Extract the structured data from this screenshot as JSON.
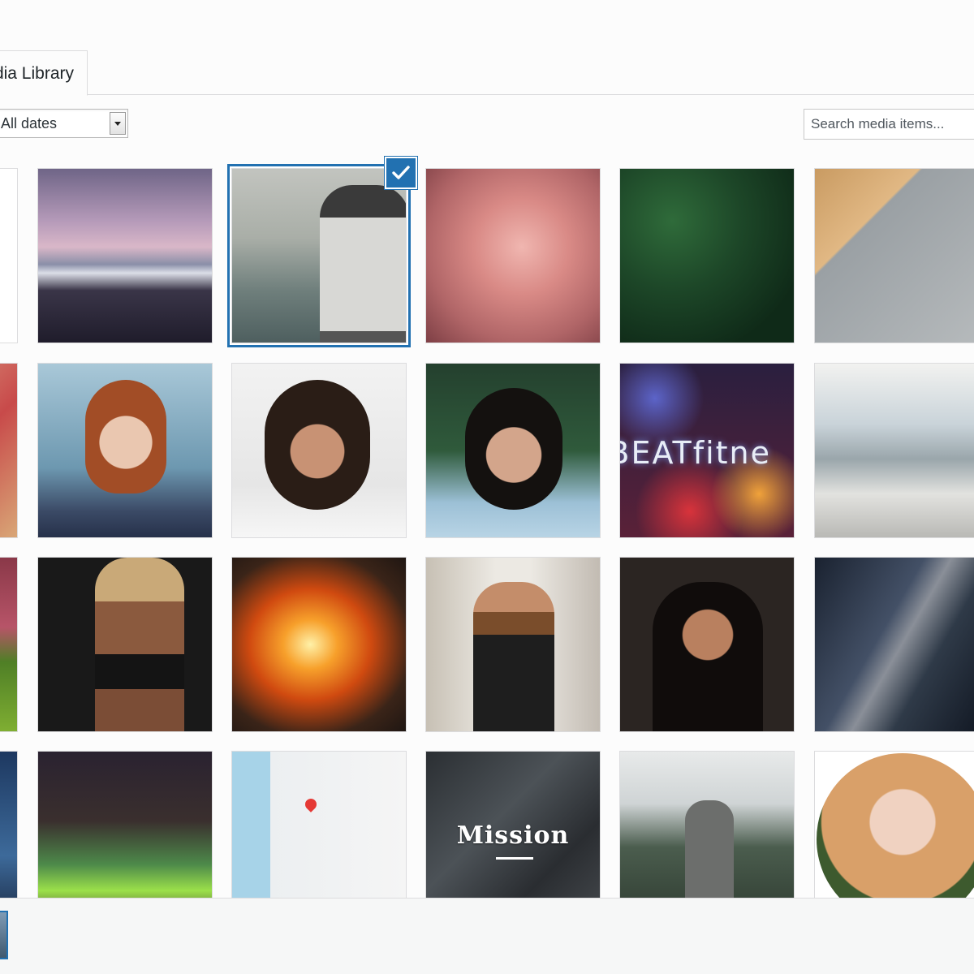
{
  "tabs": {
    "media_library": "Media Library"
  },
  "filters": {
    "dates_selected": "All dates"
  },
  "search": {
    "placeholder": "Search media items..."
  },
  "media_items": [
    {
      "row": 0,
      "col": 0,
      "subject": "blank white image"
    },
    {
      "row": 0,
      "col": 1,
      "subject": "purple sky over mountains"
    },
    {
      "row": 0,
      "col": 2,
      "subject": "man looking at misty view",
      "selected": true
    },
    {
      "row": 0,
      "col": 3,
      "subject": "pink flamingo"
    },
    {
      "row": 0,
      "col": 4,
      "subject": "aerial view of pine trees"
    },
    {
      "row": 0,
      "col": 5,
      "subject": "The Unsplash Book on wood table"
    },
    {
      "row": 1,
      "col": 0,
      "subject": "red geometric artwork"
    },
    {
      "row": 1,
      "col": 1,
      "subject": "red-haired woman portrait"
    },
    {
      "row": 1,
      "col": 2,
      "subject": "woman with curly hair"
    },
    {
      "row": 1,
      "col": 3,
      "subject": "woman among green leaves"
    },
    {
      "row": 1,
      "col": 4,
      "subject": "BEAT fitness bokeh logo"
    },
    {
      "row": 1,
      "col": 5,
      "subject": "modern house terrace"
    },
    {
      "row": 2,
      "col": 0,
      "subject": "vegetables at market"
    },
    {
      "row": 2,
      "col": 1,
      "subject": "athletic woman back"
    },
    {
      "row": 2,
      "col": 2,
      "subject": "flames on grill"
    },
    {
      "row": 2,
      "col": 3,
      "subject": "bearded man in store aisle"
    },
    {
      "row": 2,
      "col": 4,
      "subject": "woman in black turtleneck"
    },
    {
      "row": 2,
      "col": 5,
      "subject": "milky way over sea"
    },
    {
      "row": 3,
      "col": 0,
      "subject": "night sky"
    },
    {
      "row": 3,
      "col": 1,
      "subject": "green aurora"
    },
    {
      "row": 3,
      "col": 2,
      "subject": "map of Sarasota"
    },
    {
      "row": 3,
      "col": 3,
      "subject": "Mission text on dark fabric"
    },
    {
      "row": 3,
      "col": 4,
      "subject": "hiker above clouds"
    },
    {
      "row": 3,
      "col": 5,
      "subject": "woman with glasses circular photo"
    }
  ],
  "tile_text": {
    "mission": "Mission",
    "beat": "eBEATfitne"
  },
  "colors": {
    "accent": "#2271b1",
    "border": "#dcdcde",
    "background": "#fcfcfc"
  },
  "icons": {
    "selected_check": "checkmark-icon",
    "select_arrow": "chevron-down-icon"
  }
}
